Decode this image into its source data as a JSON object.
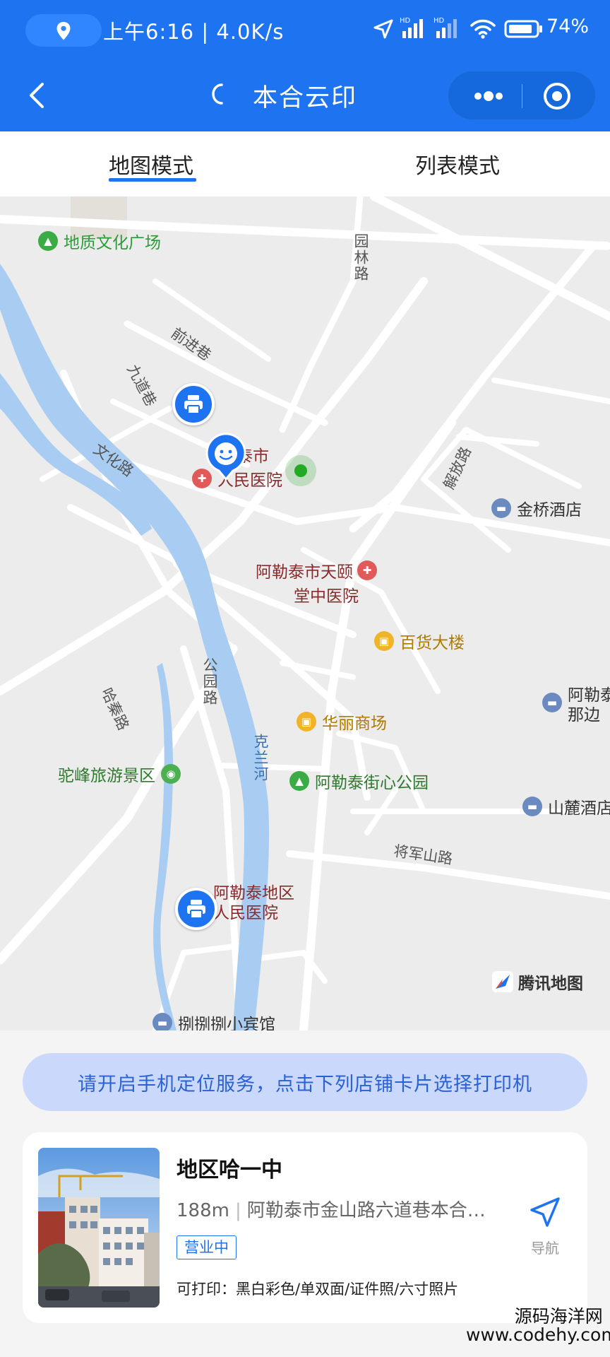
{
  "status_bar": {
    "time_speed": "上午6:16 | 4.0K/s",
    "battery": "74%",
    "icons": [
      "location-icon",
      "navigation-arrow-icon",
      "hd-signal-icon",
      "hd-signal-icon",
      "wifi-icon",
      "battery-icon"
    ]
  },
  "nav": {
    "title": "本合云印",
    "back_icon": "back-chevron-icon",
    "more_icon": "more-dots-icon",
    "close_icon": "target-close-icon"
  },
  "tabs": [
    {
      "label": "地图模式",
      "active": true
    },
    {
      "label": "列表模式",
      "active": false
    }
  ],
  "map": {
    "pois": [
      {
        "name": "地质文化广场",
        "type": "park",
        "color": "#2e9b3a"
      },
      {
        "name": "勒泰市",
        "type": "text",
        "color": "#8b2a2a"
      },
      {
        "name": "人民医院",
        "type": "hospital",
        "color": "#8b2a2a"
      },
      {
        "name": "金桥酒店",
        "type": "hotel",
        "color": "#333333"
      },
      {
        "name": "阿勒泰市天颐",
        "type": "hospital",
        "color": "#8b2a2a"
      },
      {
        "name": "堂中医院",
        "type": "text",
        "color": "#8b2a2a"
      },
      {
        "name": "百货大楼",
        "type": "shopping",
        "color": "#b07a00"
      },
      {
        "name": "阿勒泰",
        "type": "hotel",
        "color": "#333333"
      },
      {
        "name": "那边",
        "type": "text",
        "color": "#333333"
      },
      {
        "name": "华丽商场",
        "type": "shopping",
        "color": "#b07a00"
      },
      {
        "name": "驼峰旅游景区",
        "type": "scenic",
        "color": "#2e7a2e"
      },
      {
        "name": "阿勒泰街心公园",
        "type": "park",
        "color": "#2e7a2e"
      },
      {
        "name": "山麓酒店",
        "type": "hotel",
        "color": "#333333"
      },
      {
        "name": "阿勒泰地区",
        "type": "text",
        "color": "#8b2a2a"
      },
      {
        "name": "人民医院",
        "type": "text",
        "color": "#8b2a2a"
      },
      {
        "name": "捌捌捌小宾馆",
        "type": "hotel",
        "color": "#333333"
      }
    ],
    "roads": [
      "园林路",
      "前进巷",
      "九道巷",
      "文化路",
      "解放路",
      "哈秦路",
      "公园路",
      "克兰河",
      "将军山路"
    ],
    "logo_text": "腾讯地图",
    "colors": {
      "water": "#a8ccf2",
      "road": "#ffffff",
      "land": "#ececec",
      "pin": "#1e73f0"
    }
  },
  "notice": "请开启手机定位服务，点击下列店铺卡片选择打印机",
  "store": {
    "name": "地区哈一中",
    "distance": "188m",
    "address": "阿勒泰市金山路六道巷本合…",
    "status": "营业中",
    "print_label": "可打印：",
    "print_options": "黑白彩色/单双面/证件照/六寸照片",
    "nav_label": "导航",
    "nav_icon": "navigate-arrow-icon"
  },
  "watermark": {
    "line1": "源码海洋网",
    "line2": "www.codehy.com"
  }
}
